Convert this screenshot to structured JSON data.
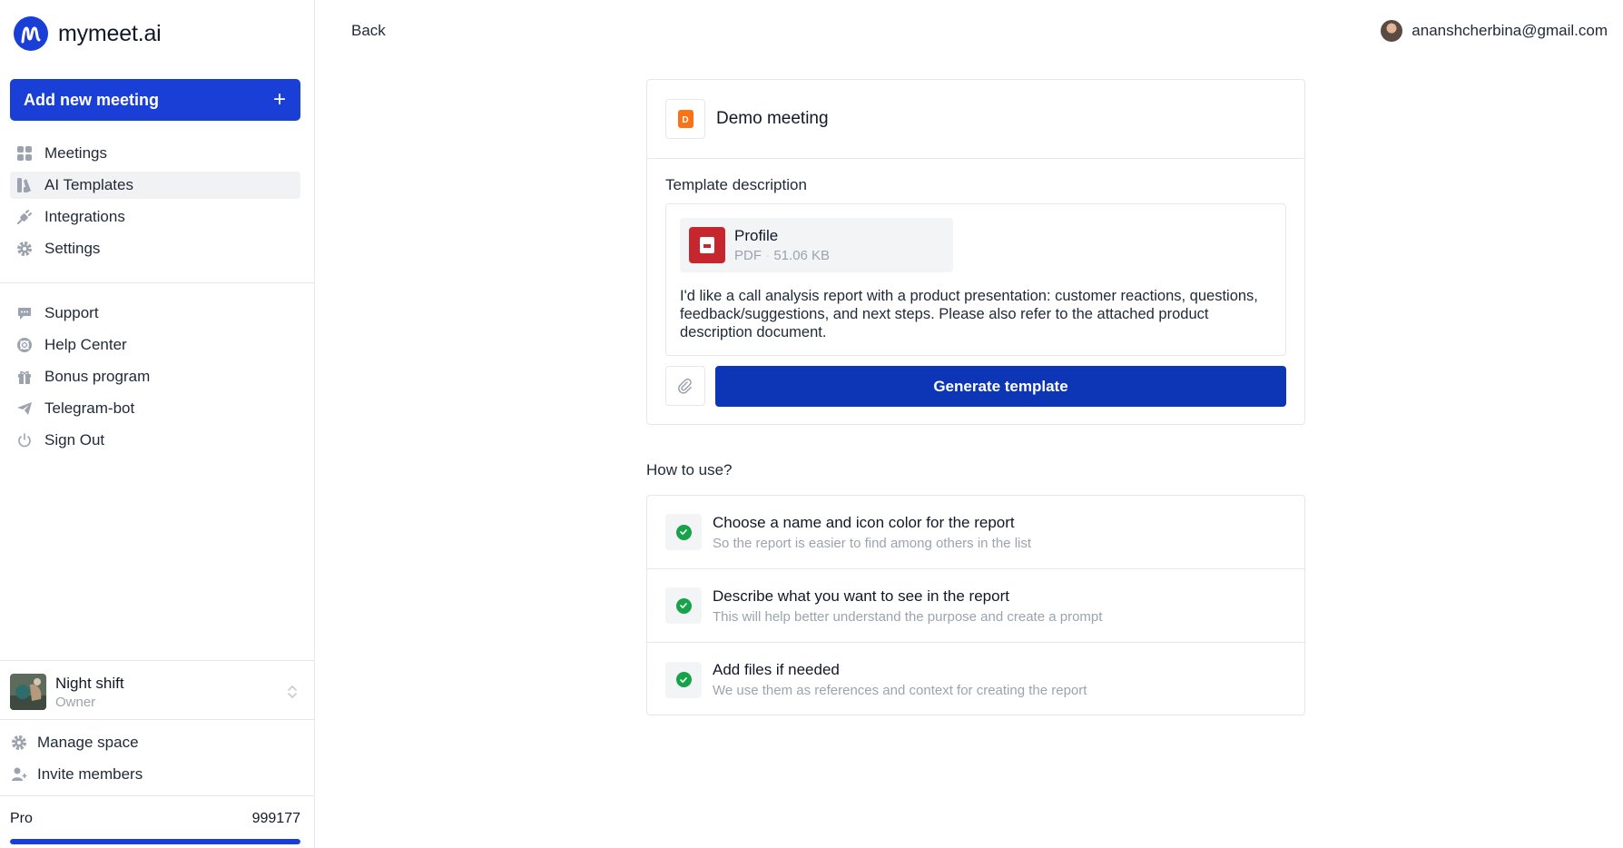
{
  "app": {
    "logo_text": "mymeet.ai"
  },
  "sidebar": {
    "add_button": {
      "label": "Add new meeting",
      "icon": "plus-icon"
    },
    "primary_nav": [
      {
        "label": "Meetings",
        "icon": "grid-icon",
        "active": false
      },
      {
        "label": "AI Templates",
        "icon": "templates-icon",
        "active": true
      },
      {
        "label": "Integrations",
        "icon": "plug-icon",
        "active": false
      },
      {
        "label": "Settings",
        "icon": "gear-icon",
        "active": false
      }
    ],
    "secondary_nav": [
      {
        "label": "Support",
        "icon": "chat-icon"
      },
      {
        "label": "Help Center",
        "icon": "lifebuoy-icon"
      },
      {
        "label": "Bonus program",
        "icon": "gift-icon"
      },
      {
        "label": "Telegram-bot",
        "icon": "send-icon"
      },
      {
        "label": "Sign Out",
        "icon": "power-icon"
      }
    ],
    "workspace": {
      "name": "Night shift",
      "role": "Owner"
    },
    "workspace_nav": [
      {
        "label": "Manage space",
        "icon": "gear-icon"
      },
      {
        "label": "Invite members",
        "icon": "user-plus-icon"
      }
    ],
    "plan": {
      "name": "Pro",
      "value": "999177",
      "progress": 1.0
    }
  },
  "header": {
    "back_label": "Back",
    "user_email": "ananshcherbina@gmail.com"
  },
  "template": {
    "title": "Demo meeting",
    "icon_letter": "D",
    "icon_color": "#f97316",
    "description_label": "Template description",
    "file": {
      "name": "Profile",
      "type": "PDF",
      "size": "51.06 KB"
    },
    "description": "I'd like a call analysis report with a product presentation: customer reactions, questions, feedback/suggestions, and next steps. Please also refer to the attached product description document.",
    "generate_label": "Generate template"
  },
  "how_to": {
    "title": "How to use?",
    "steps": [
      {
        "title": "Choose a name and icon color for the report",
        "subtitle": "So the report is easier to find among others in the list"
      },
      {
        "title": "Describe what you want to see in the report",
        "subtitle": "This will help better understand the purpose and create a prompt"
      },
      {
        "title": "Add files if needed",
        "subtitle": "We use them as references and context for creating the report"
      }
    ]
  },
  "colors": {
    "primary": "#1a3fd6",
    "generate": "#0c36b5",
    "success": "#16a34a",
    "pdf": "#c6262e"
  }
}
